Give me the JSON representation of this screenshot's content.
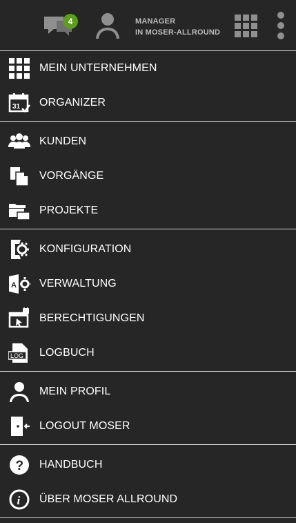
{
  "header": {
    "chat_badge_count": "4",
    "user_role": "MANAGER",
    "user_context": "IN MOSER-ALLROUND",
    "icons": [
      "chat-icon",
      "user-icon",
      "apps-grid-icon",
      "more-vertical-icon"
    ],
    "badge_color": "#5b9e19"
  },
  "menu": {
    "groups": [
      [
        {
          "label": "MEIN UNTERNEHMEN",
          "icon": "grid-icon"
        },
        {
          "label": "ORGANIZER",
          "icon": "calendar-icon"
        }
      ],
      [
        {
          "label": "KUNDEN",
          "icon": "customers-icon"
        },
        {
          "label": "VORGÄNGE",
          "icon": "documents-icon"
        },
        {
          "label": "PROJEKTE",
          "icon": "folders-icon"
        }
      ],
      [
        {
          "label": "KONFIGURATION",
          "icon": "configuration-icon"
        },
        {
          "label": "VERWALTUNG",
          "icon": "administration-icon"
        },
        {
          "label": "BERECHTIGUNGEN",
          "icon": "permissions-icon"
        },
        {
          "label": "LOGBUCH",
          "icon": "logbook-icon"
        }
      ],
      [
        {
          "label": "MEIN PROFIL",
          "icon": "profile-icon"
        },
        {
          "label": "LOGOUT MOSER",
          "icon": "logout-icon"
        }
      ],
      [
        {
          "label": "HANDBUCH",
          "icon": "help-icon"
        },
        {
          "label": "ÜBER MOSER ALLROUND",
          "icon": "info-icon"
        }
      ]
    ]
  },
  "colors": {
    "background": "#262626",
    "text": "#ffffff",
    "separator": "#d8d8d8",
    "muted_text": "#bdbdbd"
  }
}
